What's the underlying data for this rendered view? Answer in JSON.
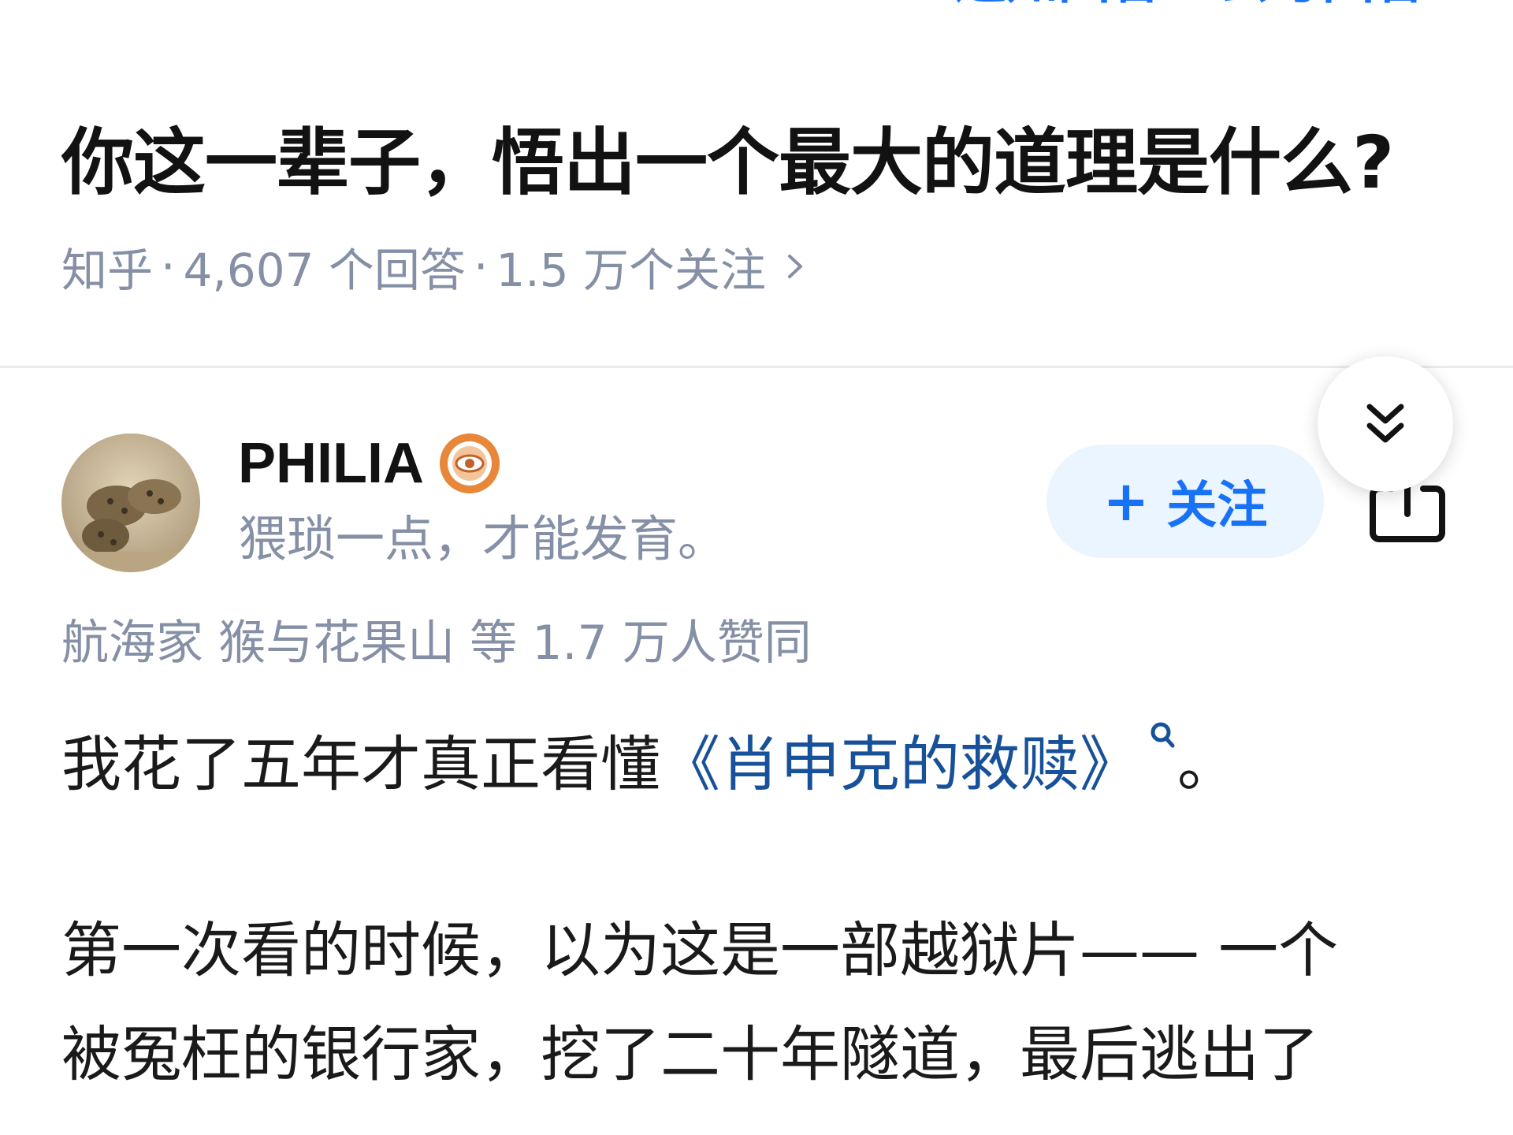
{
  "nav": {
    "right_text": "…通知回答 · 去写回答"
  },
  "question": {
    "title": "你这一辈子，悟出一个最大的道理是什么?",
    "source": "知乎",
    "answers": "4,607 个回答",
    "followers": "1.5 万个关注",
    "separator": "·"
  },
  "author": {
    "name": "PHILIA",
    "bio": "猥琐一点，才能发育。",
    "follow_label": "关注",
    "follow_plus": "+"
  },
  "upvotes": "航海家 猴与花果山 等 1.7 万人赞同",
  "answer": {
    "p1_before": "我花了五年才真正看懂",
    "p1_link": "《肖申克的救赎》",
    "p1_after": "。",
    "p2": "第一次看的时候，以为这是一部越狱片—— 一个",
    "p3": "被冤枉的银行家，挖了二十年隧道，最后逃出了"
  },
  "colors": {
    "accent": "#1772f6",
    "link": "#175199",
    "meta_gray": "#8590a6",
    "follow_bg": "#ebf5ff",
    "badge_orange": "#e8863a"
  },
  "icons": {
    "back": "chevron-left-icon",
    "meta_chevron": "chevron-right-icon",
    "badge": "eye-badge-icon",
    "collapse": "double-chevron-down-icon",
    "share": "share-icon",
    "search": "search-icon"
  }
}
